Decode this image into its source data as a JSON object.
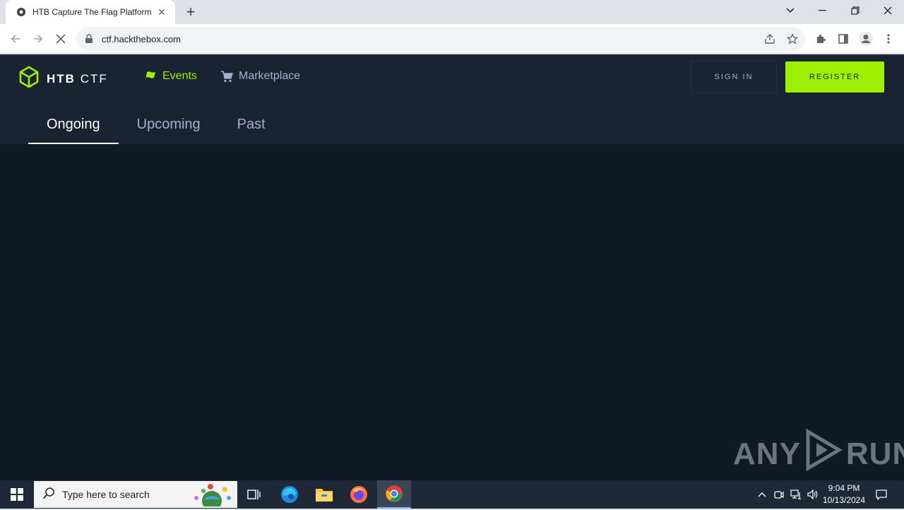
{
  "browser": {
    "tab_title": "HTB Capture The Flag Platform |",
    "url": "ctf.hackthebox.com"
  },
  "site": {
    "logo_text": "HTB",
    "logo_suffix": "CTF",
    "nav": {
      "events_label": "Events",
      "marketplace_label": "Marketplace"
    },
    "sign_in_label": "SIGN IN",
    "register_label": "REGISTER",
    "event_tabs": [
      "Ongoing",
      "Upcoming",
      "Past"
    ],
    "active_tab": "Ongoing"
  },
  "colors": {
    "accent": "#9fef00",
    "nav_bg": "#1a2332",
    "page_bg": "#111927"
  },
  "watermark": {
    "left": "ANY",
    "right": "RUN"
  },
  "taskbar": {
    "search_placeholder": "Type here to search",
    "time": "9:04 PM",
    "date": "10/13/2024"
  }
}
